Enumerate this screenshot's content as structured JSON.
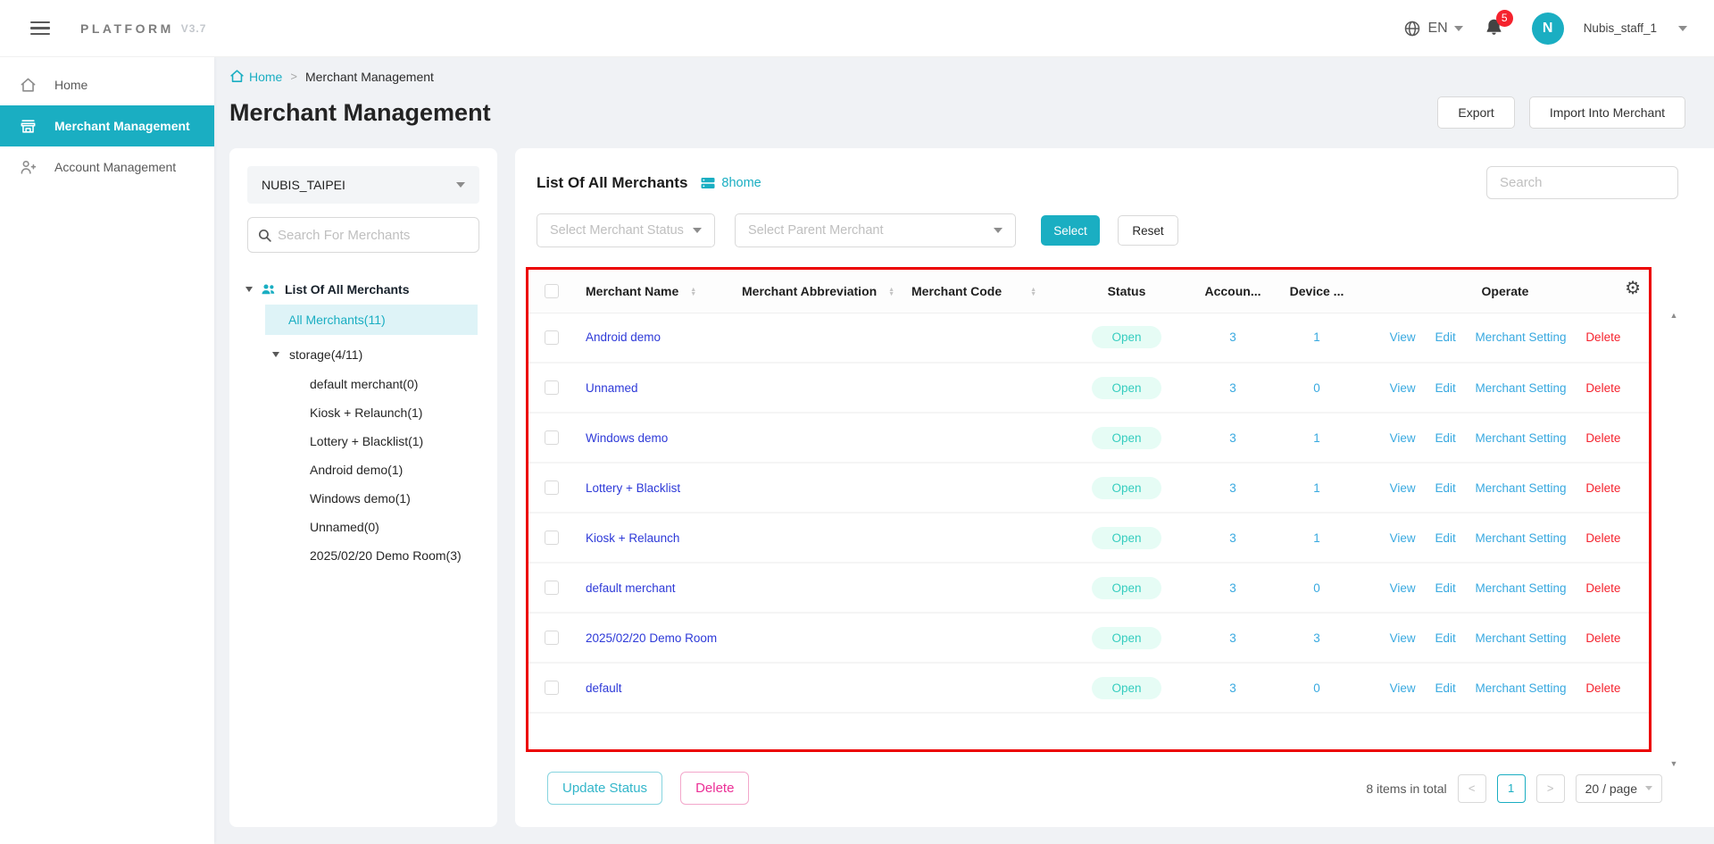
{
  "topbar": {
    "brand": "PLATFORM",
    "version": "V3.7",
    "language": "EN",
    "notification_count": "5",
    "avatar_initial": "N",
    "username": "Nubis_staff_1"
  },
  "sidebar": {
    "items": [
      {
        "label": "Home"
      },
      {
        "label": "Merchant Management"
      },
      {
        "label": "Account Management"
      }
    ]
  },
  "breadcrumb": {
    "home": "Home",
    "separator": ">",
    "current": "Merchant Management"
  },
  "page": {
    "title": "Merchant Management",
    "buttons": {
      "export": "Export",
      "import": "Import Into Merchant"
    }
  },
  "merchant_panel": {
    "org_name": "NUBIS_TAIPEI",
    "search_placeholder": "Search For Merchants",
    "tree": {
      "root_label": "List Of All Merchants",
      "selected_item": "All Merchants(11)",
      "group_label": "storage(4/11)",
      "children": [
        {
          "label": "default merchant(0)"
        },
        {
          "label": "Kiosk + Relaunch(1)"
        },
        {
          "label": "Lottery + Blacklist(1)"
        },
        {
          "label": "Android demo(1)"
        },
        {
          "label": "Windows demo(1)"
        },
        {
          "label": "Unnamed(0)"
        },
        {
          "label": "2025/02/20 Demo Room(3)"
        }
      ]
    }
  },
  "main": {
    "title": "List Of All Merchants",
    "subtitle_link": "8home",
    "search_placeholder": "Search",
    "filters": {
      "status_placeholder": "Select Merchant Status",
      "parent_placeholder": "Select Parent Merchant",
      "select_button": "Select",
      "reset_button": "Reset"
    },
    "table": {
      "headers": {
        "name": "Merchant Name",
        "abbreviation": "Merchant Abbreviation",
        "code": "Merchant Code",
        "status": "Status",
        "account": "Accoun...",
        "device": "Device ...",
        "operate": "Operate"
      },
      "operate": {
        "view": "View",
        "edit": "Edit",
        "setting": "Merchant Setting",
        "delete": "Delete"
      },
      "rows": [
        {
          "name": "Android demo",
          "abbreviation": "",
          "code": "",
          "status": "Open",
          "accounts": "3",
          "devices": "1"
        },
        {
          "name": "Unnamed",
          "abbreviation": "",
          "code": "",
          "status": "Open",
          "accounts": "3",
          "devices": "0"
        },
        {
          "name": "Windows demo",
          "abbreviation": "",
          "code": "",
          "status": "Open",
          "accounts": "3",
          "devices": "1"
        },
        {
          "name": "Lottery + Blacklist",
          "abbreviation": "",
          "code": "",
          "status": "Open",
          "accounts": "3",
          "devices": "1"
        },
        {
          "name": "Kiosk + Relaunch",
          "abbreviation": "",
          "code": "",
          "status": "Open",
          "accounts": "3",
          "devices": "1"
        },
        {
          "name": "default merchant",
          "abbreviation": "",
          "code": "",
          "status": "Open",
          "accounts": "3",
          "devices": "0"
        },
        {
          "name": "2025/02/20 Demo Room",
          "abbreviation": "",
          "code": "",
          "status": "Open",
          "accounts": "3",
          "devices": "3"
        },
        {
          "name": "default",
          "abbreviation": "",
          "code": "",
          "status": "Open",
          "accounts": "3",
          "devices": "0"
        }
      ]
    },
    "footer": {
      "update_status": "Update Status",
      "delete": "Delete",
      "total": "8 items in total",
      "prev": "<",
      "page": "1",
      "next": ">",
      "page_size": "20 / page"
    }
  },
  "colors": {
    "primary": "#1aaec2",
    "link": "#38a9e0",
    "merchant_link": "#2e3ad8",
    "status_badge_bg": "#e6fcf5",
    "status_badge_text": "#34cdbf",
    "delete_red": "#f5222d",
    "pink": "#eb2f96",
    "annotation_border": "#ec0000",
    "notification_badge": "#f5222d",
    "selected_tree_bg": "#def3f7"
  }
}
